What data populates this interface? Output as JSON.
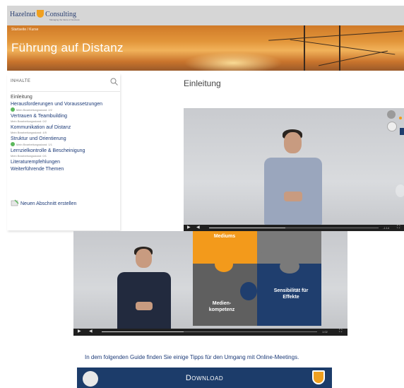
{
  "brand": {
    "name_left": "Hazelnut",
    "name_right": "Consulting",
    "tagline": "Managing the future of business"
  },
  "hero": {
    "breadcrumb": "Startseite / Kurse",
    "title": "Führung auf Distanz"
  },
  "toc": {
    "heading": "INHALTE",
    "items": [
      {
        "label": "Einleitung",
        "meta": "",
        "done": false,
        "plain": true
      },
      {
        "label": "Herausforderungen und Voraussetzungen",
        "meta": "Mein Bearbeitungsstand: 2/2",
        "done": true,
        "plain": false
      },
      {
        "label": "Vertrauen & Teambuilding",
        "meta": "Mein Bearbeitungsstand: 0/2",
        "done": false,
        "plain": false
      },
      {
        "label": "Kommunikation auf Distanz",
        "meta": "Mein Bearbeitungsstand: 4/5",
        "done": false,
        "plain": false
      },
      {
        "label": "Struktur und Orientierung",
        "meta": "Mein Bearbeitungsstand: 1/1",
        "done": true,
        "plain": false
      },
      {
        "label": "Lernzielkontrolle & Bescheinigung",
        "meta": "Mein Bearbeitungsstand: 0/1",
        "done": false,
        "plain": false
      },
      {
        "label": "Literaturempfehlungen",
        "meta": "",
        "done": false,
        "plain": false
      },
      {
        "label": "Weiterführende Themen",
        "meta": "",
        "done": false,
        "plain": false
      }
    ],
    "new_section": "Neuen Abschnitt erstellen"
  },
  "main": {
    "title": "Einleitung",
    "video1": {
      "time": "-1:14",
      "progress": 0.45
    },
    "video2": {
      "time": "1:02",
      "progress": 0.38,
      "puzzle": {
        "top": "Mediums",
        "left": "Medien-\nkompetenz",
        "right": "Sensibilität für\nEffekte"
      }
    },
    "intro_text": "In dem folgenden Guide finden Sie einige Tipps für den Umgang mit Online-Meetings.",
    "download_label": "Download"
  },
  "colors": {
    "brand_blue": "#1d3b78",
    "orange": "#f39a1b",
    "navy": "#1f3e6e",
    "check_green": "#5cb85c"
  }
}
